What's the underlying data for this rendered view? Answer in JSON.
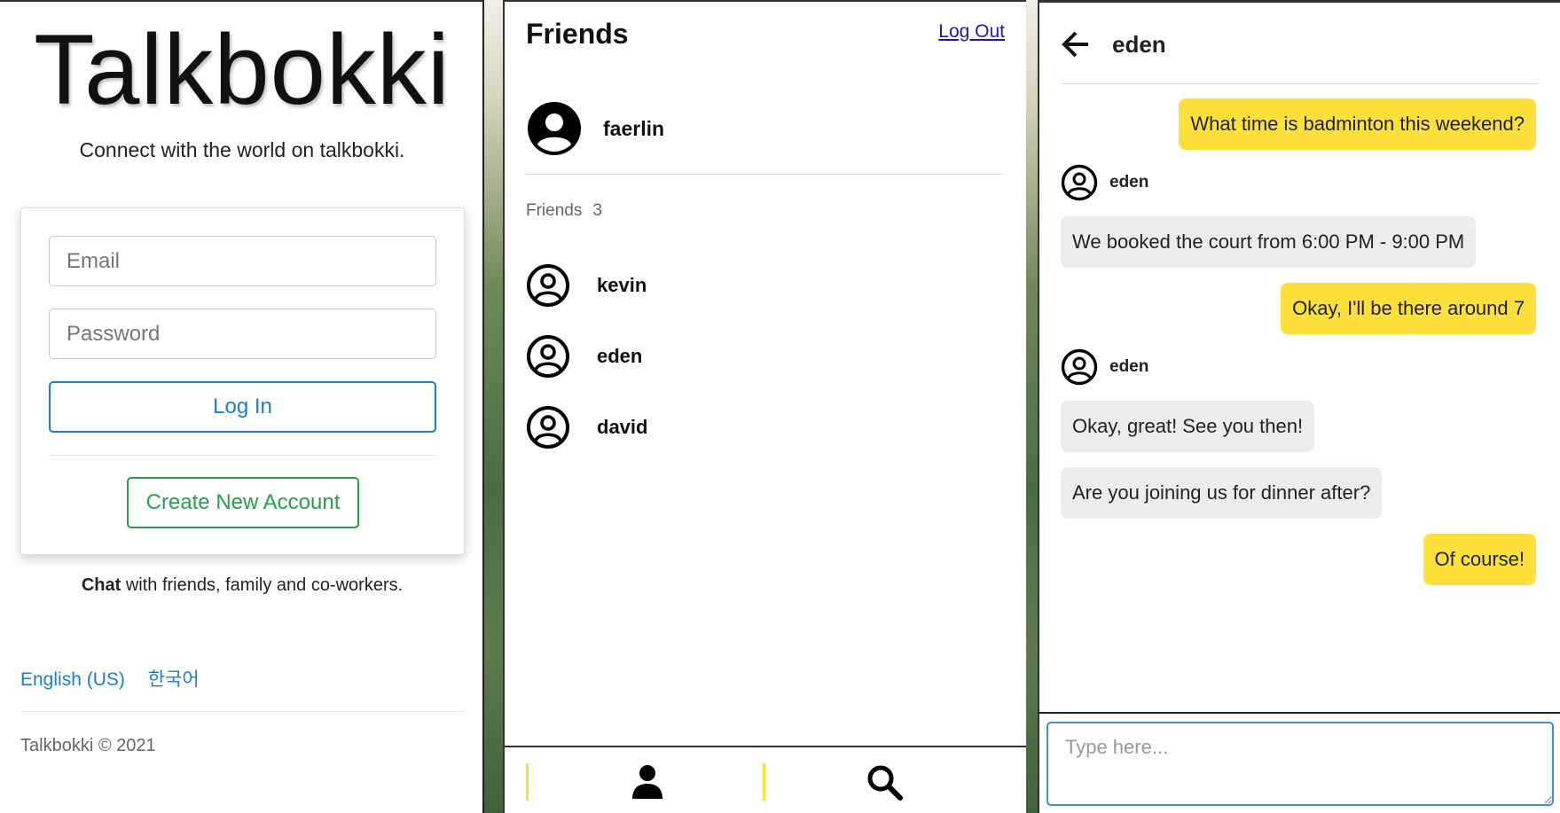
{
  "login": {
    "brand": "Talkbokki",
    "tagline": "Connect with the world on talkbokki.",
    "email_placeholder": "Email",
    "password_placeholder": "Password",
    "login_button": "Log In",
    "create_account_button": "Create New Account",
    "chat_line_bold": "Chat",
    "chat_line_rest": " with friends, family and co-workers.",
    "languages": [
      "English (US)",
      "한국어"
    ],
    "copyright": "Talkbokki © 2021",
    "colors": {
      "primary": "#1a7ed4",
      "success": "#25a04b"
    }
  },
  "friends": {
    "title": "Friends",
    "logout": "Log Out",
    "me": {
      "name": "faerlin",
      "icon": "user-circle-filled-icon"
    },
    "count_label": "Friends",
    "count": "3",
    "list": [
      {
        "name": "kevin",
        "icon": "user-circle-outline-icon"
      },
      {
        "name": "eden",
        "icon": "user-circle-outline-icon"
      },
      {
        "name": "david",
        "icon": "user-circle-outline-icon"
      }
    ],
    "nav": {
      "profile_icon": "person-icon",
      "search_icon": "search-icon",
      "separator_color": "#ffe031"
    }
  },
  "chat": {
    "peer": "eden",
    "back_icon": "arrow-left-icon",
    "messages": [
      {
        "from": "me",
        "text": "What time is badminton this weekend?"
      },
      {
        "from": "eden",
        "text": "We booked the court from 6:00 PM - 9:00 PM"
      },
      {
        "from": "me",
        "text": "Okay, I'll be there around 7"
      },
      {
        "from": "eden",
        "text": "Okay, great! See you then!"
      },
      {
        "from": "eden",
        "text": "Are you joining us for dinner after?"
      },
      {
        "from": "me",
        "text": "Of course!"
      }
    ],
    "input_placeholder": "Type here...",
    "colors": {
      "my_bubble": "#fde13a",
      "their_bubble": "#ececec"
    }
  }
}
